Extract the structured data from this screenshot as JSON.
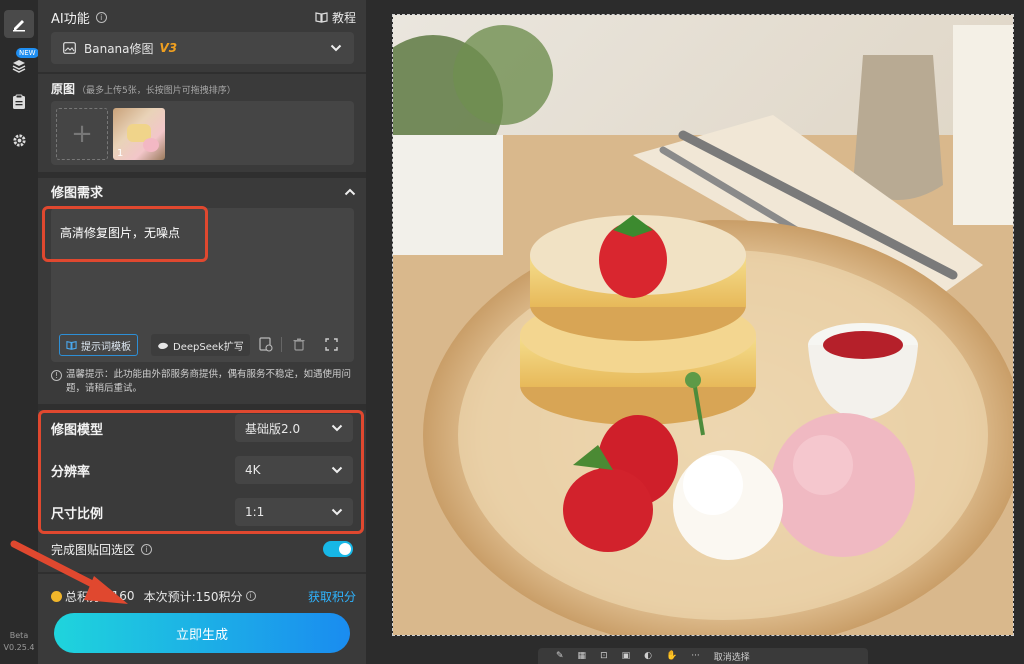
{
  "rail": {
    "new_badge": "NEW",
    "beta": "Beta",
    "version": "V0.25.4"
  },
  "panel": {
    "ai_title": "AI功能",
    "tutorial_label": "教程",
    "model_select": {
      "name": "Banana修图",
      "version": "V3"
    },
    "source_title": "原图",
    "source_hint": "（最多上传5张，长按图片可拖拽排序）",
    "thumb_index": "1",
    "requirement_title": "修图需求",
    "prompt_text": "高清修复图片，无噪点",
    "prompt_template_button": "提示词模板",
    "deepseek_button": "DeepSeek扩写",
    "tip": "温馨提示：此功能由外部服务商提供，偶有服务不稳定，如遇使用问题，请稍后重试。",
    "options": [
      {
        "label": "修图模型",
        "value": "基础版2.0"
      },
      {
        "label": "分辨率",
        "value": "4K"
      },
      {
        "label": "尺寸比例",
        "value": "1:1"
      }
    ],
    "paste_back_label": "完成图贴回选区",
    "paste_back_on": true,
    "points_label": "总积分",
    "points_value": "8160",
    "estimate": "本次预计:150积分",
    "get_points": "获取积分",
    "generate_button": "立即生成"
  },
  "toolbar": {
    "cancel_selection": "取消选择"
  },
  "colors": {
    "accent": "#17b7e6",
    "highlight": "#e0482f",
    "version_badge": "#f0a020",
    "link": "#2fb4ff"
  }
}
